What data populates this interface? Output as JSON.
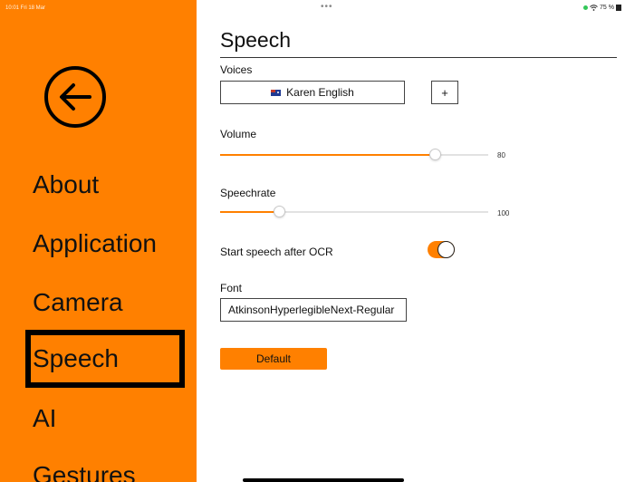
{
  "status_bar": {
    "time": "10:01 Fri 18 Mar",
    "center_dots": "•••",
    "battery_text": "75 %",
    "wifi_icon": "wifi-icon"
  },
  "sidebar": {
    "background": "#ff8000",
    "back_icon": "arrow-left-circle-icon",
    "items": [
      {
        "label": "About",
        "selected": false
      },
      {
        "label": "Application",
        "selected": false
      },
      {
        "label": "Camera",
        "selected": false
      },
      {
        "label": "Speech",
        "selected": true
      },
      {
        "label": "AI",
        "selected": false
      },
      {
        "label": "Gestures",
        "selected": false
      }
    ]
  },
  "main": {
    "title": "Speech",
    "voices": {
      "label": "Voices",
      "selected_voice": "Karen English",
      "flag_icon": "australia-flag-icon",
      "add_label": "+"
    },
    "volume": {
      "label": "Volume",
      "value": 80,
      "value_text": "80",
      "fraction": 0.8
    },
    "speechrate": {
      "label": "Speechrate",
      "value": 100,
      "value_text": "100",
      "fraction": 0.22
    },
    "start_speech": {
      "label": "Start speech after OCR",
      "enabled": true
    },
    "font": {
      "label": "Font",
      "value": "AtkinsonHyperlegibleNext-Regular"
    },
    "default_label": "Default",
    "accent": "#ff8000"
  }
}
